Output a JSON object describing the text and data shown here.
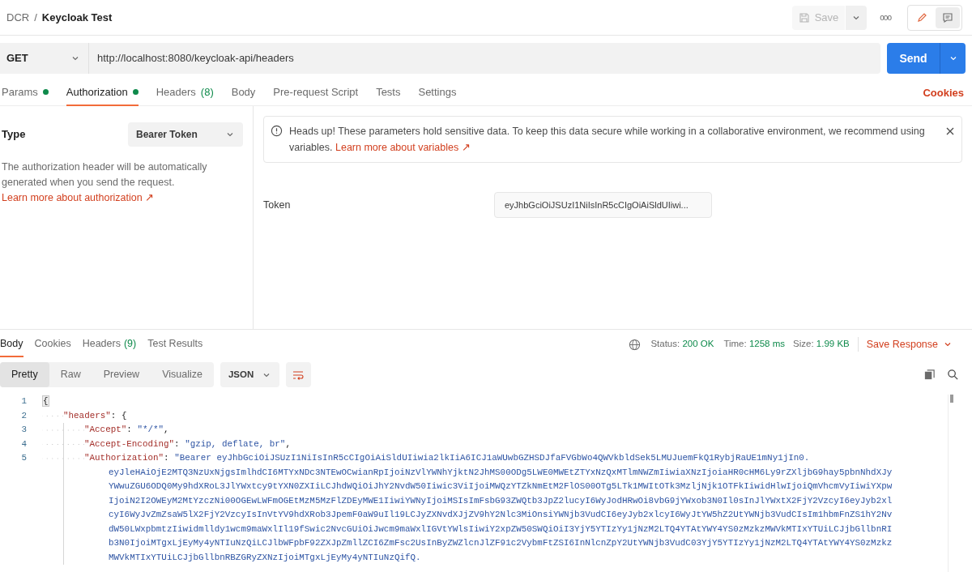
{
  "breadcrumb": {
    "parent": "DCR",
    "separator": "/",
    "title": "Keycloak Test"
  },
  "toolbar": {
    "save": "Save",
    "more": "ooo"
  },
  "request": {
    "method": "GET",
    "url": "http://localhost:8080/keycloak-api/headers",
    "send": "Send"
  },
  "request_tabs": [
    {
      "label": "Params",
      "dot": true,
      "selected": false
    },
    {
      "label": "Authorization",
      "dot": true,
      "selected": true
    },
    {
      "label": "Headers",
      "count": "(8)",
      "dot": false,
      "selected": false
    },
    {
      "label": "Body",
      "dot": false,
      "selected": false
    },
    {
      "label": "Pre-request Script",
      "dot": false,
      "selected": false
    },
    {
      "label": "Tests",
      "dot": false,
      "selected": false
    },
    {
      "label": "Settings",
      "dot": false,
      "selected": false
    }
  ],
  "cookies_link": "Cookies",
  "auth": {
    "type_label": "Type",
    "type_value": "Bearer Token",
    "description": "The authorization header will be automatically generated when you send the request.",
    "learn_more": "Learn more about authorization ↗",
    "notice": "Heads up! These parameters hold sensitive data. To keep this data secure while working in a collaborative environment, we recommend using variables.",
    "notice_link": "Learn more about variables ↗",
    "token_label": "Token",
    "token_value": "eyJhbGciOiJSUzI1NiIsInR5cCIgOiAiSldUIiwi..."
  },
  "response_tabs": [
    {
      "label": "Body",
      "selected": true
    },
    {
      "label": "Cookies",
      "selected": false
    },
    {
      "label": "Headers",
      "count": "(9)",
      "selected": false
    },
    {
      "label": "Test Results",
      "selected": false
    }
  ],
  "status": {
    "status_label": "Status:",
    "status_value": "200 OK",
    "time_label": "Time:",
    "time_value": "1258 ms",
    "size_label": "Size:",
    "size_value": "1.99 KB",
    "save_response": "Save Response"
  },
  "view_modes": [
    {
      "label": "Pretty",
      "selected": true
    },
    {
      "label": "Raw",
      "selected": false
    },
    {
      "label": "Preview",
      "selected": false
    },
    {
      "label": "Visualize",
      "selected": false
    }
  ],
  "format": "JSON",
  "code": [
    {
      "number": "1",
      "tokens": [
        {
          "kind": "punct",
          "text": "{"
        }
      ],
      "children": [
        {
          "number": "2",
          "tokens": [
            {
              "kind": "key",
              "text": "\"headers\""
            },
            {
              "kind": "punct",
              "text": ": {"
            }
          ],
          "children": [
            {
              "number": "3",
              "tokens": [
                {
                  "kind": "key",
                  "text": "\"Accept\""
                },
                {
                  "kind": "punct",
                  "text": ": "
                },
                {
                  "kind": "string",
                  "text": "\"*/*\""
                },
                {
                  "kind": "punct",
                  "text": ","
                }
              ]
            },
            {
              "number": "4",
              "tokens": [
                {
                  "kind": "key",
                  "text": "\"Accept-Encoding\""
                },
                {
                  "kind": "punct",
                  "text": ": "
                },
                {
                  "kind": "string",
                  "text": "\"gzip, deflate, br\""
                },
                {
                  "kind": "punct",
                  "text": ","
                }
              ]
            },
            {
              "number": "5",
              "tokens": [
                {
                  "kind": "key",
                  "text": "\"Authorization\""
                },
                {
                  "kind": "punct",
                  "text": ": "
                },
                {
                  "kind": "string",
                  "text": "\"Bearer eyJhbGciOiJSUzI1NiIsInR5cCIgOiAiSldUIiwia2lkIiA6ICJ1aWUwbGZHSDJfaFVGbWo4QWVkbldSek5LMUJuemFkQ1RybjRaUE1mNy1jIn0."
                }
              ],
              "wrapped": [
                "eyJleHAiOjE2MTQ3NzUxNjgsImlhdCI6MTYxNDc3NTEwOCwianRpIjoiNzVlYWNhYjktN2JhMS00ODg5LWE0MWEtZTYxNzQxMTlmNWZmIiwiaXNzIjoiaHR0cHM6Ly9rZXljbG9hay5pbnNhdXJy",
                "YWwuZGU6ODQ0My9hdXRoL3JlYWxtcy9tYXN0ZXIiLCJhdWQiOiJhY2NvdW50Iiwic3ViIjoiMWQzYTZkNmEtM2FlOS00OTg5LTk1MWItOTk3MzljNjk1OTFkIiwidHlwIjoiQmVhcmVyIiwiYXpw",
                "IjoiN2I2OWEyM2MtYzczNi00OGEwLWFmOGEtMzM5MzFlZDEyMWE1IiwiYWNyIjoiMSIsImFsbG93ZWQtb3JpZ2lucyI6WyJodHRwOi8vbG9jYWxob3N0Il0sInJlYWxtX2FjY2VzcyI6eyJyb2xl",
                "cyI6WyJvZmZsaW5lX2FjY2VzcyIsInVtYV9hdXRob3JpemF0aW9uIl19LCJyZXNvdXJjZV9hY2Nlc3MiOnsiYWNjb3VudCI6eyJyb2xlcyI6WyJtYW5hZ2UtYWNjb3VudCIsIm1hbmFnZS1hY2Nv",
                "dW50LWxpbmtzIiwidmlldy1wcm9maWxlIl19fSwic2NvcGUiOiJwcm9maWxlIGVtYWlsIiwiY2xpZW50SWQiOiI3YjY5YTIzYy1jNzM2LTQ4YTAtYWY4YS0zMzkzMWVkMTIxYTUiLCJjbGllbnRI",
                "b3N0IjoiMTgxLjEyMy4yNTIuNzQiLCJlbWFpbF92ZXJpZmllZCI6ZmFsc2UsInByZWZlcnJlZF91c2VybmFtZSI6InNlcnZpY2UtYWNjb3VudC03YjY5YTIzYy1jNzM2LTQ4YTAtYWY4YS0zMzkz",
                "MWVkMTIxYTUiLCJjbGllbnRBZGRyZXNzIjoiMTgxLjEyMy4yNTIuNzQifQ."
              ]
            }
          ]
        }
      ]
    }
  ]
}
